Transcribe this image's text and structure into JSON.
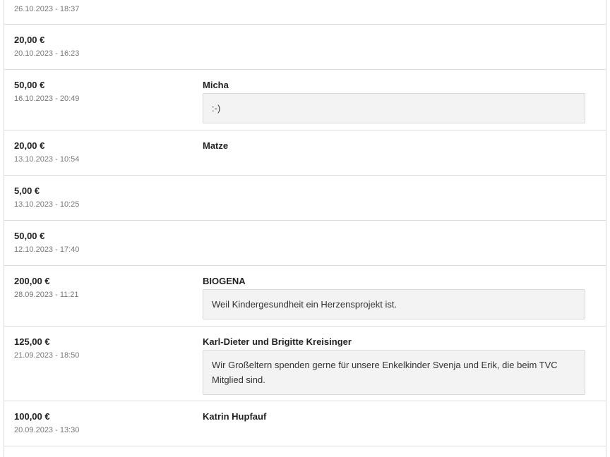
{
  "donations": [
    {
      "amount": "",
      "date": "26.10.2023 - 18:37",
      "donor": "",
      "message": ""
    },
    {
      "amount": "20,00 €",
      "date": "20.10.2023 - 16:23",
      "donor": "",
      "message": ""
    },
    {
      "amount": "50,00 €",
      "date": "16.10.2023 - 20:49",
      "donor": "Micha",
      "message": ":-)"
    },
    {
      "amount": "20,00 €",
      "date": "13.10.2023 - 10:54",
      "donor": "Matze",
      "message": ""
    },
    {
      "amount": "5,00 €",
      "date": "13.10.2023 - 10:25",
      "donor": "",
      "message": ""
    },
    {
      "amount": "50,00 €",
      "date": "12.10.2023 - 17:40",
      "donor": "",
      "message": ""
    },
    {
      "amount": "200,00 €",
      "date": "28.09.2023 - 11:21",
      "donor": "BIOGENA",
      "message": "Weil Kindergesundheit ein Herzensprojekt ist."
    },
    {
      "amount": "125,00 €",
      "date": "21.09.2023 - 18:50",
      "donor": "Karl-Dieter und Brigitte Kreisinger",
      "message": "Wir Großeltern spenden gerne für unsere Enkelkinder Svenja und Erik, die beim TVC Mitglied sind."
    },
    {
      "amount": "100,00 €",
      "date": "20.09.2023 - 13:30",
      "donor": "Katrin Hupfauf",
      "message": ""
    }
  ]
}
